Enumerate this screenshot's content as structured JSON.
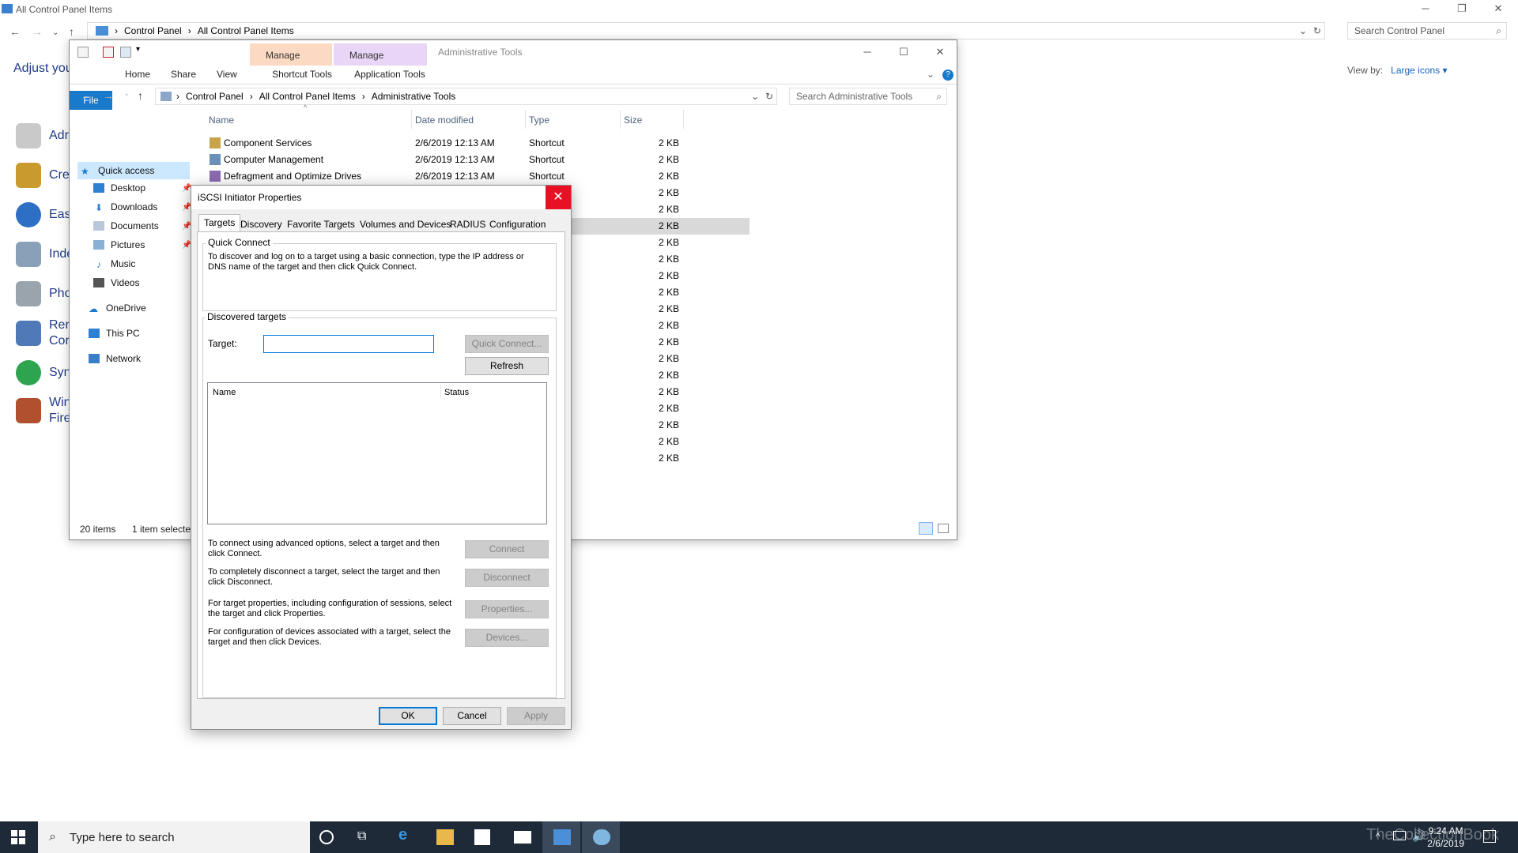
{
  "bg": {
    "title": "All Control Panel Items",
    "breadcrumb": [
      "Control Panel",
      "All Control Panel Items"
    ],
    "search_placeholder": "Search Control Panel",
    "heading": "Adjust you",
    "view_by_label": "View by:",
    "view_by_value": "Large icons ▾",
    "items": [
      "Adr",
      "Cre",
      "Eas",
      "Inde",
      "Pho",
      "Rer\nCor",
      "Syn",
      "Win\nFire"
    ]
  },
  "explorer": {
    "title": "Administrative Tools",
    "ribbon_ctx": [
      {
        "header": "Manage",
        "tab": "Shortcut Tools",
        "color": "#fcd9c2"
      },
      {
        "header": "Manage",
        "tab": "Application Tools",
        "color": "#e9d5f6"
      }
    ],
    "tabs": [
      "File",
      "Home",
      "Share",
      "View"
    ],
    "breadcrumb": [
      "Control Panel",
      "All Control Panel Items",
      "Administrative Tools"
    ],
    "search_placeholder": "Search Administrative Tools",
    "nav": [
      {
        "label": "Quick access",
        "icon": "star-icon"
      },
      {
        "label": "Desktop",
        "icon": "desktop-icon"
      },
      {
        "label": "Downloads",
        "icon": "download-icon"
      },
      {
        "label": "Documents",
        "icon": "documents-icon"
      },
      {
        "label": "Pictures",
        "icon": "pictures-icon"
      },
      {
        "label": "Music",
        "icon": "music-icon"
      },
      {
        "label": "Videos",
        "icon": "videos-icon"
      },
      {
        "label": "OneDrive",
        "icon": "cloud-icon"
      },
      {
        "label": "This PC",
        "icon": "pc-icon"
      },
      {
        "label": "Network",
        "icon": "network-icon"
      }
    ],
    "columns": [
      "Name",
      "Date modified",
      "Type",
      "Size"
    ],
    "files": [
      {
        "name": "Component Services",
        "date": "2/6/2019 12:13 AM",
        "type": "Shortcut",
        "size": "2 KB"
      },
      {
        "name": "Computer Management",
        "date": "2/6/2019 12:13 AM",
        "type": "Shortcut",
        "size": "2 KB"
      },
      {
        "name": "Defragment and Optimize Drives",
        "date": "2/6/2019 12:13 AM",
        "type": "Shortcut",
        "size": "2 KB"
      }
    ],
    "size_only": [
      "2 KB",
      "2 KB",
      "2 KB",
      "2 KB",
      "2 KB",
      "2 KB",
      "2 KB",
      "2 KB",
      "2 KB",
      "2 KB",
      "2 KB",
      "2 KB",
      "2 KB",
      "2 KB",
      "2 KB",
      "2 KB",
      "2 KB"
    ],
    "status_count": "20 items",
    "status_selected": "1 item selected"
  },
  "dialog": {
    "title": "iSCSI Initiator Properties",
    "tabs": [
      "Targets",
      "Discovery",
      "Favorite Targets",
      "Volumes and Devices",
      "RADIUS",
      "Configuration"
    ],
    "quick_connect_label": "Quick Connect",
    "quick_connect_text": "To discover and log on to a target using a basic connection, type the IP address or DNS name of the target and then click Quick Connect.",
    "target_label": "Target:",
    "target_value": "",
    "quick_connect_button": "Quick Connect...",
    "discovered_label": "Discovered targets",
    "refresh_button": "Refresh",
    "list_columns": [
      "Name",
      "Status"
    ],
    "connect_text": "To connect using advanced options, select a target and then click Connect.",
    "connect_button": "Connect",
    "disconnect_text": "To completely disconnect a target, select the target and then click Disconnect.",
    "disconnect_button": "Disconnect",
    "properties_text": "For target properties, including configuration of sessions, select the target and click Properties.",
    "properties_button": "Properties...",
    "devices_text": "For configuration of devices associated with a target, select the target and then click Devices.",
    "devices_button": "Devices...",
    "ok": "OK",
    "cancel": "Cancel",
    "apply": "Apply"
  },
  "taskbar": {
    "search_placeholder": "Type here to search",
    "time": "9:24 AM",
    "date": "2/6/2019",
    "watermark": "TheCollectionBook"
  },
  "colors": {
    "accent": "#0078d7",
    "close_red": "#e81123",
    "taskbar": "#1e2a38"
  }
}
